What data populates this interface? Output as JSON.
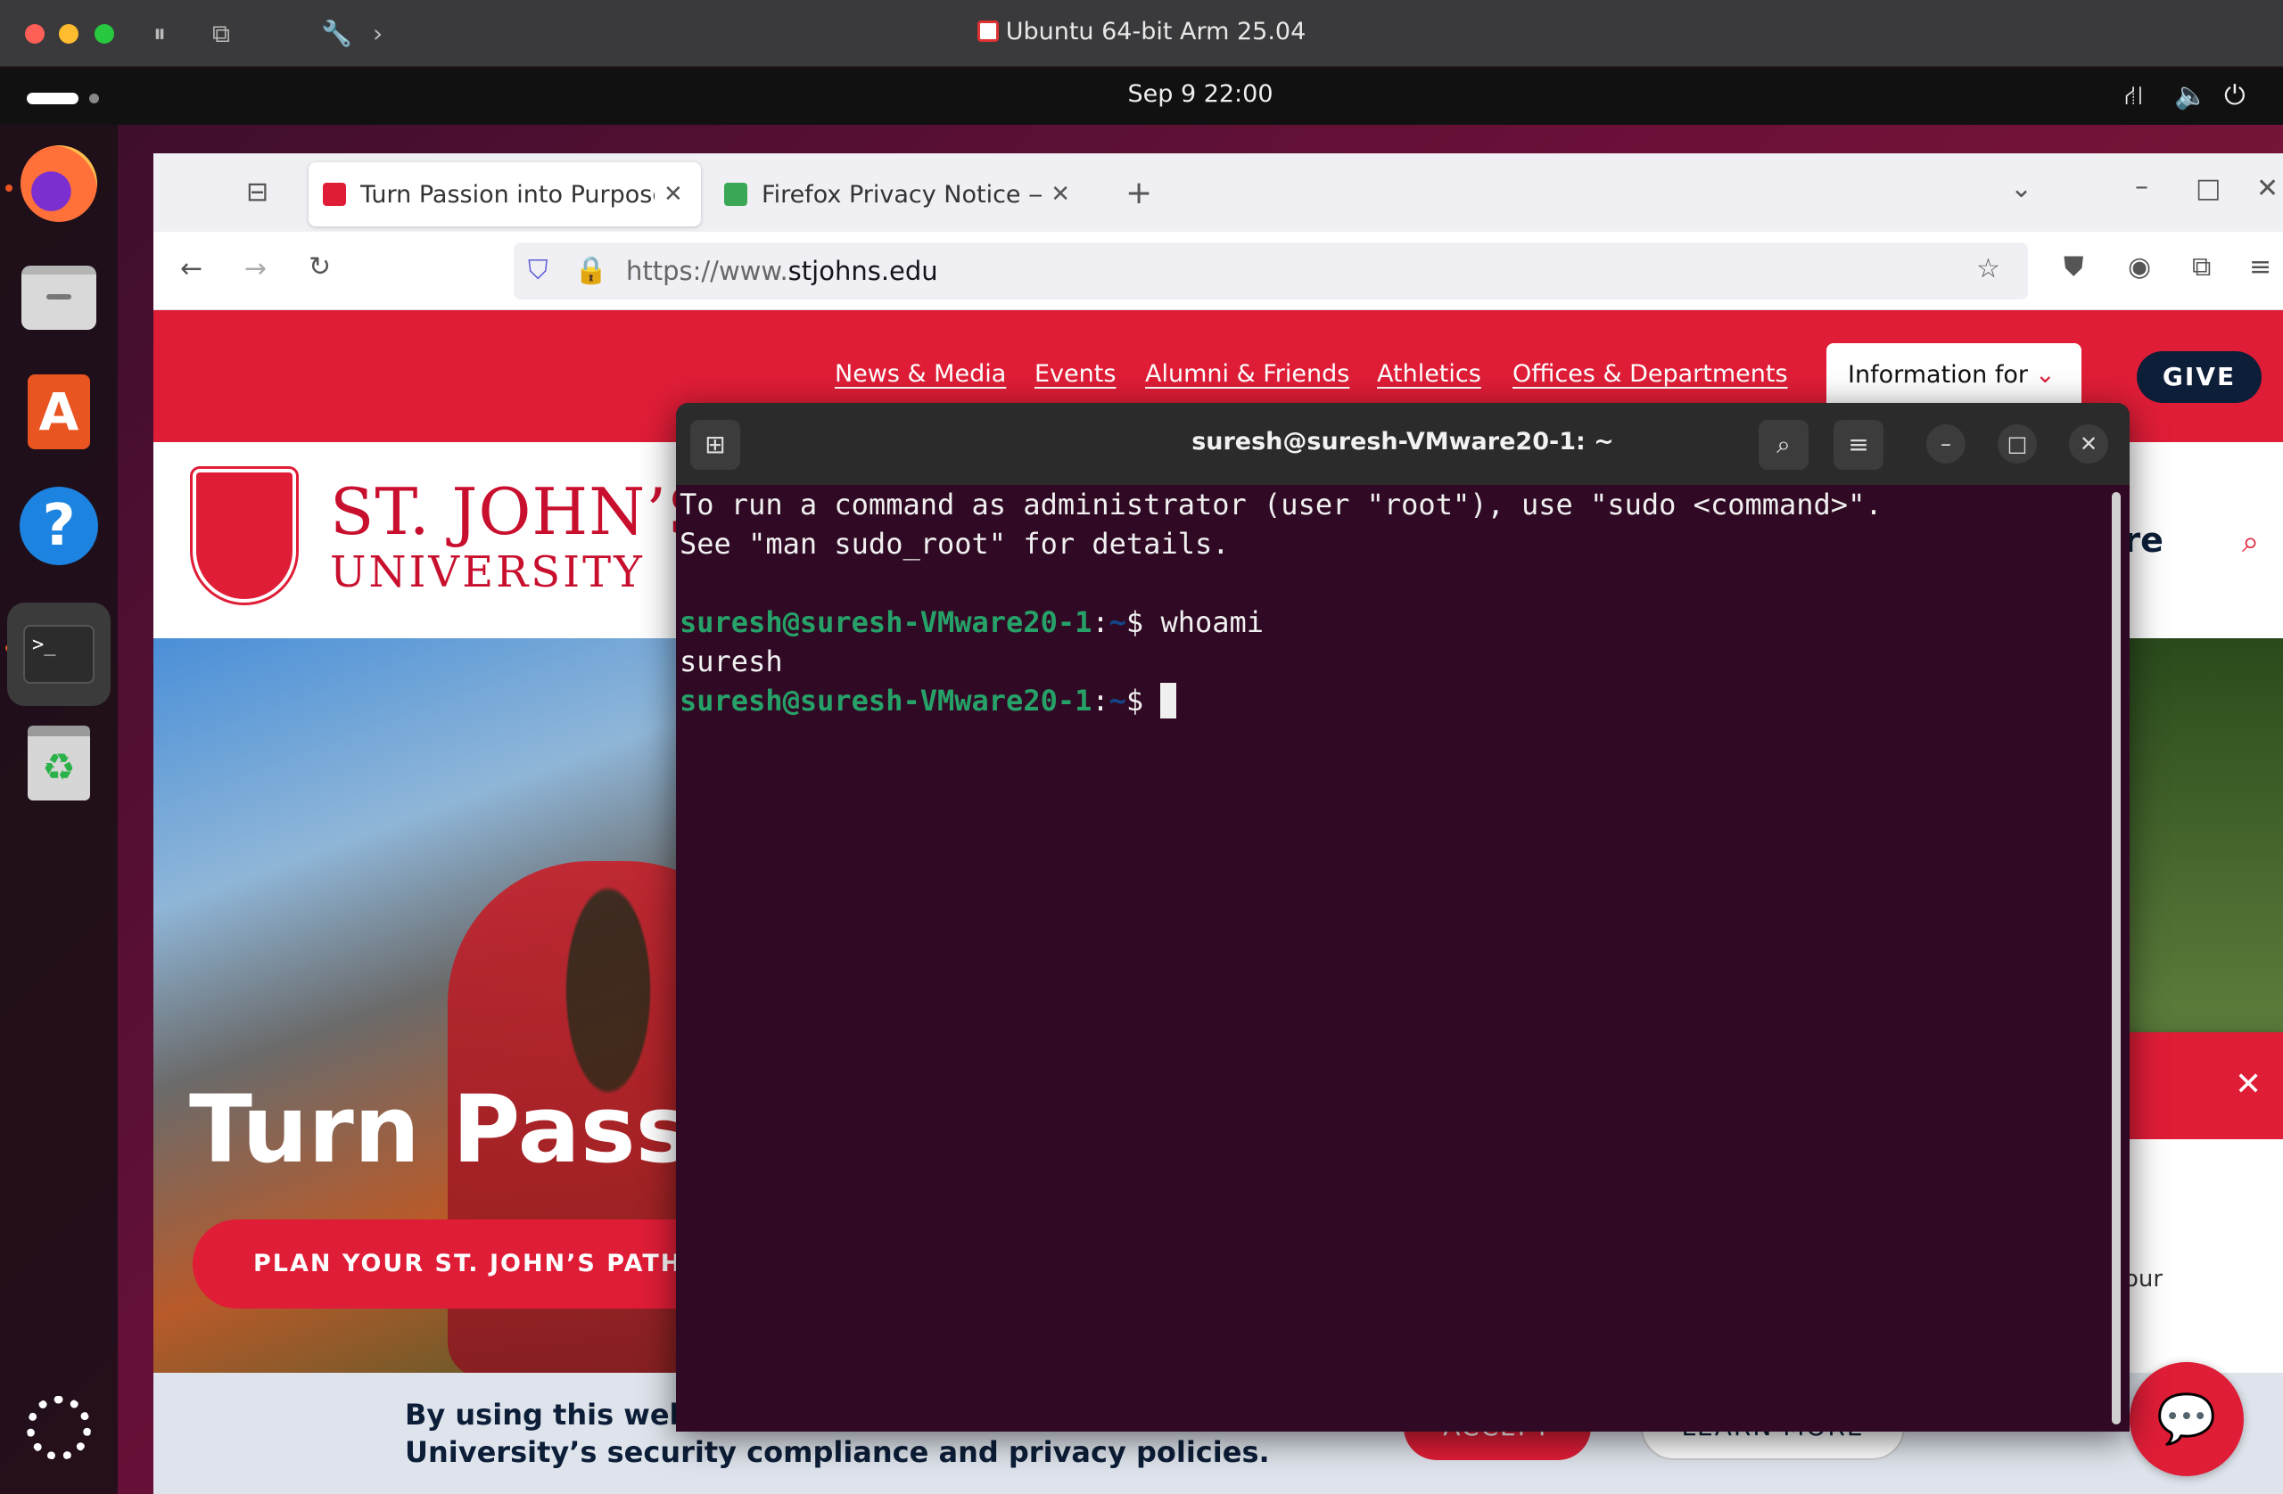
{
  "host": {
    "window_title": "Ubuntu 64-bit Arm 25.04"
  },
  "topbar": {
    "clock": "Sep 9  22:00"
  },
  "dock": {
    "items": [
      "firefox-icon",
      "files-icon",
      "app-center-icon",
      "help-icon",
      "terminal-icon",
      "trash-icon",
      "show-apps-icon"
    ]
  },
  "firefox": {
    "tabs": [
      {
        "label": "Turn Passion into Purpose",
        "active": true
      },
      {
        "label": "Firefox Privacy Notice — I",
        "active": false
      }
    ],
    "url_prefix": "https://www.",
    "url_domain": "stjohns.edu"
  },
  "site": {
    "nav": [
      "News & Media",
      "Events",
      "Alumni & Friends",
      "Athletics",
      "Offices & Departments"
    ],
    "info_label": "Information for",
    "give_label": "GIVE",
    "logo_line1": "ST. JOHN’S",
    "logo_line2": "UNIVERSITY",
    "header_partial": "Are",
    "hero_title": "Turn Passio",
    "hero_button": "PLAN YOUR ST. JOHN’S PATHWAY",
    "chat_partial": "our",
    "consent_text": "By using this website you consent to St. John’s University’s security compliance and privacy policies.",
    "accept_label": "ACCEPT",
    "learn_more_label": "LEARN MORE",
    "brand_red": "#e01d37"
  },
  "terminal": {
    "title": "suresh@suresh-VMware20-1: ~",
    "line1": "To run a command as administrator (user \"root\"), use \"sudo <command>\".",
    "line2": "See \"man sudo_root\" for details.",
    "prompt_user": "suresh@suresh-VMware20-1",
    "prompt_sep": ":",
    "prompt_path": "~",
    "prompt_dollar": "$ ",
    "command1": "whoami",
    "output1": "suresh",
    "background": "#300a24"
  }
}
